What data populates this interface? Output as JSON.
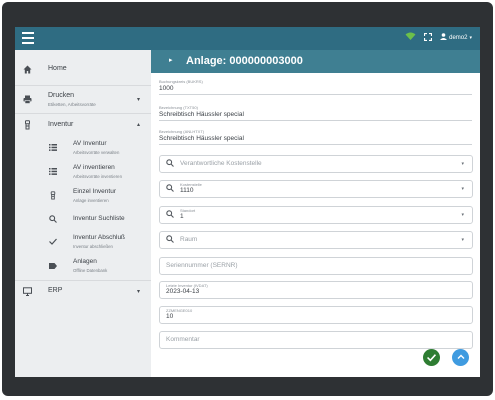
{
  "topbar": {
    "user_label": "demo2",
    "icons": [
      "menu-icon",
      "wifi-icon",
      "fullscreen-icon",
      "user-icon",
      "chevron-down-icon"
    ]
  },
  "sidebar": {
    "home": {
      "label": "Home"
    },
    "print": {
      "label": "Drucken",
      "sub": "Etiketten, Arbeitsvorräte"
    },
    "inventory": {
      "label": "Inventur"
    },
    "inventory_items": [
      {
        "label": "AV Inventur",
        "sub": "Arbeitsvorräte verwalten"
      },
      {
        "label": "AV inventieren",
        "sub": "Arbeitsvorräte inventieren"
      },
      {
        "label": "Einzel Inventur",
        "sub": "Anlage inventieren"
      },
      {
        "label": "Inventur Suchliste",
        "sub": ""
      },
      {
        "label": "Inventur Abschluß",
        "sub": "Inventur abschließen"
      },
      {
        "label": "Anlagen",
        "sub": "Offline Datenbank"
      }
    ],
    "erp": {
      "label": "ERP"
    }
  },
  "header": {
    "title": "Anlage: 000000003000"
  },
  "form": {
    "bukrs": {
      "label": "Buchungskreis (BUKRS)",
      "value": "1000"
    },
    "txt50": {
      "label": "Bezeichnung (TXT50)",
      "value": "Schreibtisch Häussler special"
    },
    "anlhtxt": {
      "label": "Bezeichnung (ANLHTXT)",
      "value": "Schreibtisch Häussler special"
    },
    "kostenstelle_ph": "Verantwortliche Kostenstelle",
    "kostenstelle": {
      "label": "Kostenstelle",
      "value": "1110"
    },
    "standort": {
      "label": "Standort",
      "value": "1"
    },
    "raum_ph": "Raum",
    "sernr_ph": "Seriennummer (SERNR)",
    "ivdat": {
      "label": "Letzte Inventur (IVDAT)",
      "value": "2023-04-13"
    },
    "zzmenge": {
      "label": "ZZMENGE010",
      "value": "10"
    },
    "kommentar_ph": "Kommentar"
  },
  "colors": {
    "topbar": "#2f6c82",
    "header": "#3f7f92",
    "confirm": "#2e7d32",
    "scroll_up": "#3f9be0"
  }
}
